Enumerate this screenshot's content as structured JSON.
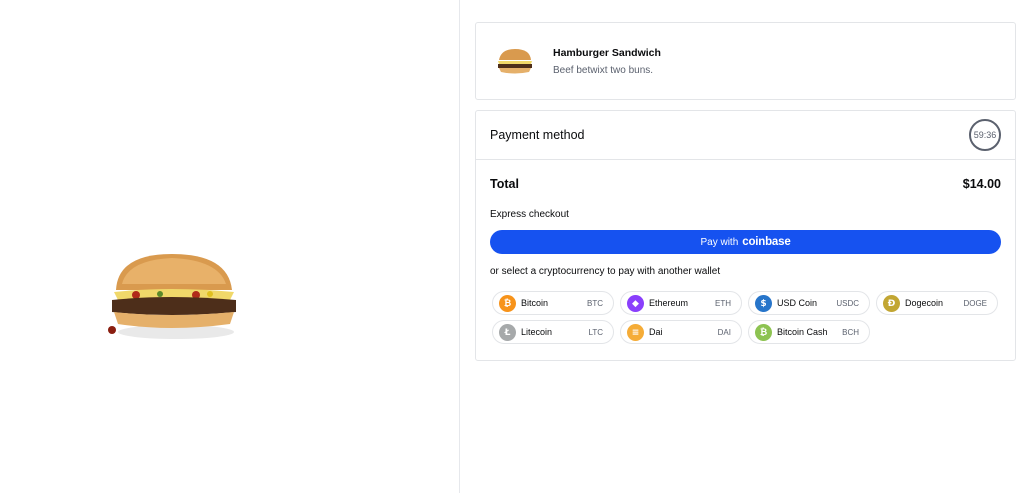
{
  "product": {
    "name": "Hamburger Sandwich",
    "description": "Beef betwixt two buns."
  },
  "payment": {
    "title": "Payment method",
    "timer": "59:36",
    "total_label": "Total",
    "total_value": "$14.00",
    "express_label": "Express checkout",
    "pay_button_prefix": "Pay with",
    "pay_button_brand": "coinbase",
    "or_label": "or select a cryptocurrency to pay with another wallet"
  },
  "coins": [
    {
      "name": "Bitcoin",
      "code": "BTC",
      "color": "#f7931a",
      "glyph": "₿"
    },
    {
      "name": "Ethereum",
      "code": "ETH",
      "color": "#8a3ffc",
      "glyph": "◆"
    },
    {
      "name": "USD Coin",
      "code": "USDC",
      "color": "#2775ca",
      "glyph": "$"
    },
    {
      "name": "Dogecoin",
      "code": "DOGE",
      "color": "#c2a633",
      "glyph": "Đ"
    },
    {
      "name": "Litecoin",
      "code": "LTC",
      "color": "#a6a9aa",
      "glyph": "Ł"
    },
    {
      "name": "Dai",
      "code": "DAI",
      "color": "#f5ac37",
      "glyph": "≡"
    },
    {
      "name": "Bitcoin Cash",
      "code": "BCH",
      "color": "#8dc351",
      "glyph": "₿"
    }
  ],
  "colors": {
    "accent": "#1652f0",
    "border": "#e3e5e8",
    "muted_text": "#5b616e"
  }
}
